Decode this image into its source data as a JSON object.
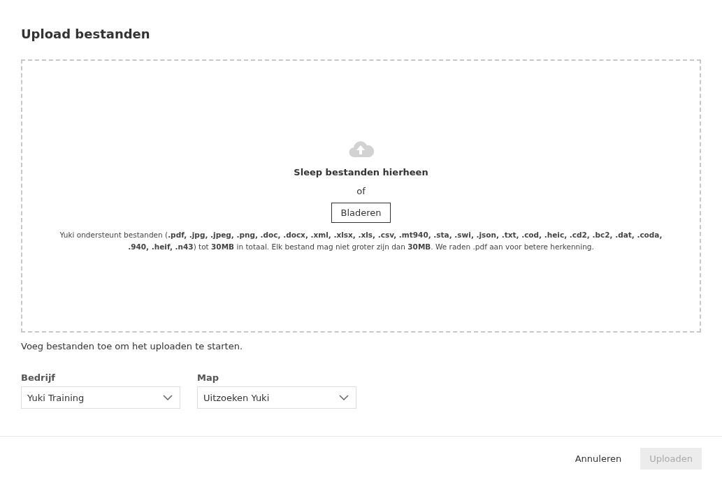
{
  "title": "Upload bestanden",
  "dropzone": {
    "heading": "Sleep bestanden hierheen",
    "separator": "of",
    "browse_button": "Bladeren",
    "info": "Yuki ondersteunt bestanden (**.pdf, .jpg, .jpeg, .png, .doc, .docx, .xml, .xlsx, .xls, .csv, .mt940, .sta, .swi, .json, .txt, .cod, .heic, .cd2, .bc2, .dat, .coda, .940, .heif, .n43**) tot **30MB** in totaal. Elk bestand mag niet groter zijn dan **30MB**. We raden .pdf aan voor betere herkenning."
  },
  "hint": "Voeg bestanden toe om het uploaden te starten.",
  "selects": [
    {
      "label": "Bedrijf",
      "value": "Yuki Training"
    },
    {
      "label": "Map",
      "value": "Uitzoeken Yuki"
    }
  ],
  "buttons": [
    {
      "label": "Annuleren",
      "kind": "text",
      "disabled": false
    },
    {
      "label": "Uploaden",
      "kind": "primary",
      "disabled": true
    }
  ]
}
